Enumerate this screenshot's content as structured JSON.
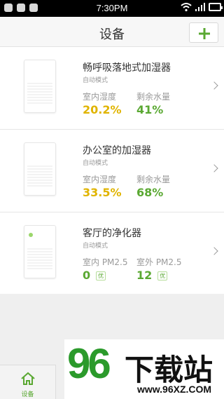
{
  "status_bar": {
    "time": "7:30PM",
    "left_icons": [
      "person-icon",
      "chat-icon",
      "mail-icon"
    ],
    "right_icons": [
      "wifi-icon",
      "signal-icon",
      "battery-icon"
    ]
  },
  "header": {
    "title": "设备",
    "add_icon": "plus-icon"
  },
  "devices": [
    {
      "name": "畅呼吸落地式加湿器",
      "mode": "自动模式",
      "metric1_label": "室内湿度",
      "metric1_value": "20.2%",
      "metric1_color": "#e0b400",
      "metric2_label": "剩余水量",
      "metric2_value": "41%",
      "metric2_color": "#5aa832"
    },
    {
      "name": "办公室的加湿器",
      "mode": "自动模式",
      "metric1_label": "室内湿度",
      "metric1_value": "33.5%",
      "metric1_color": "#e0b400",
      "metric2_label": "剩余水量",
      "metric2_value": "68%",
      "metric2_color": "#5aa832"
    },
    {
      "name": "客厅的净化器",
      "mode": "自动模式",
      "metric1_label": "室内 PM2.5",
      "metric1_value": "0",
      "metric1_badge": "优",
      "metric1_color": "#5aa832",
      "metric2_label": "室外 PM2.5",
      "metric2_value": "12",
      "metric2_badge": "优",
      "metric2_color": "#5aa832"
    }
  ],
  "tabbar": {
    "home_label": "设备",
    "home_icon": "home-icon"
  },
  "watermark": {
    "brand_number": "96",
    "brand_text": "下载站",
    "url": "www.96XZ.COM"
  },
  "colors": {
    "accent_green": "#5aa832",
    "yellow": "#e0b400"
  }
}
